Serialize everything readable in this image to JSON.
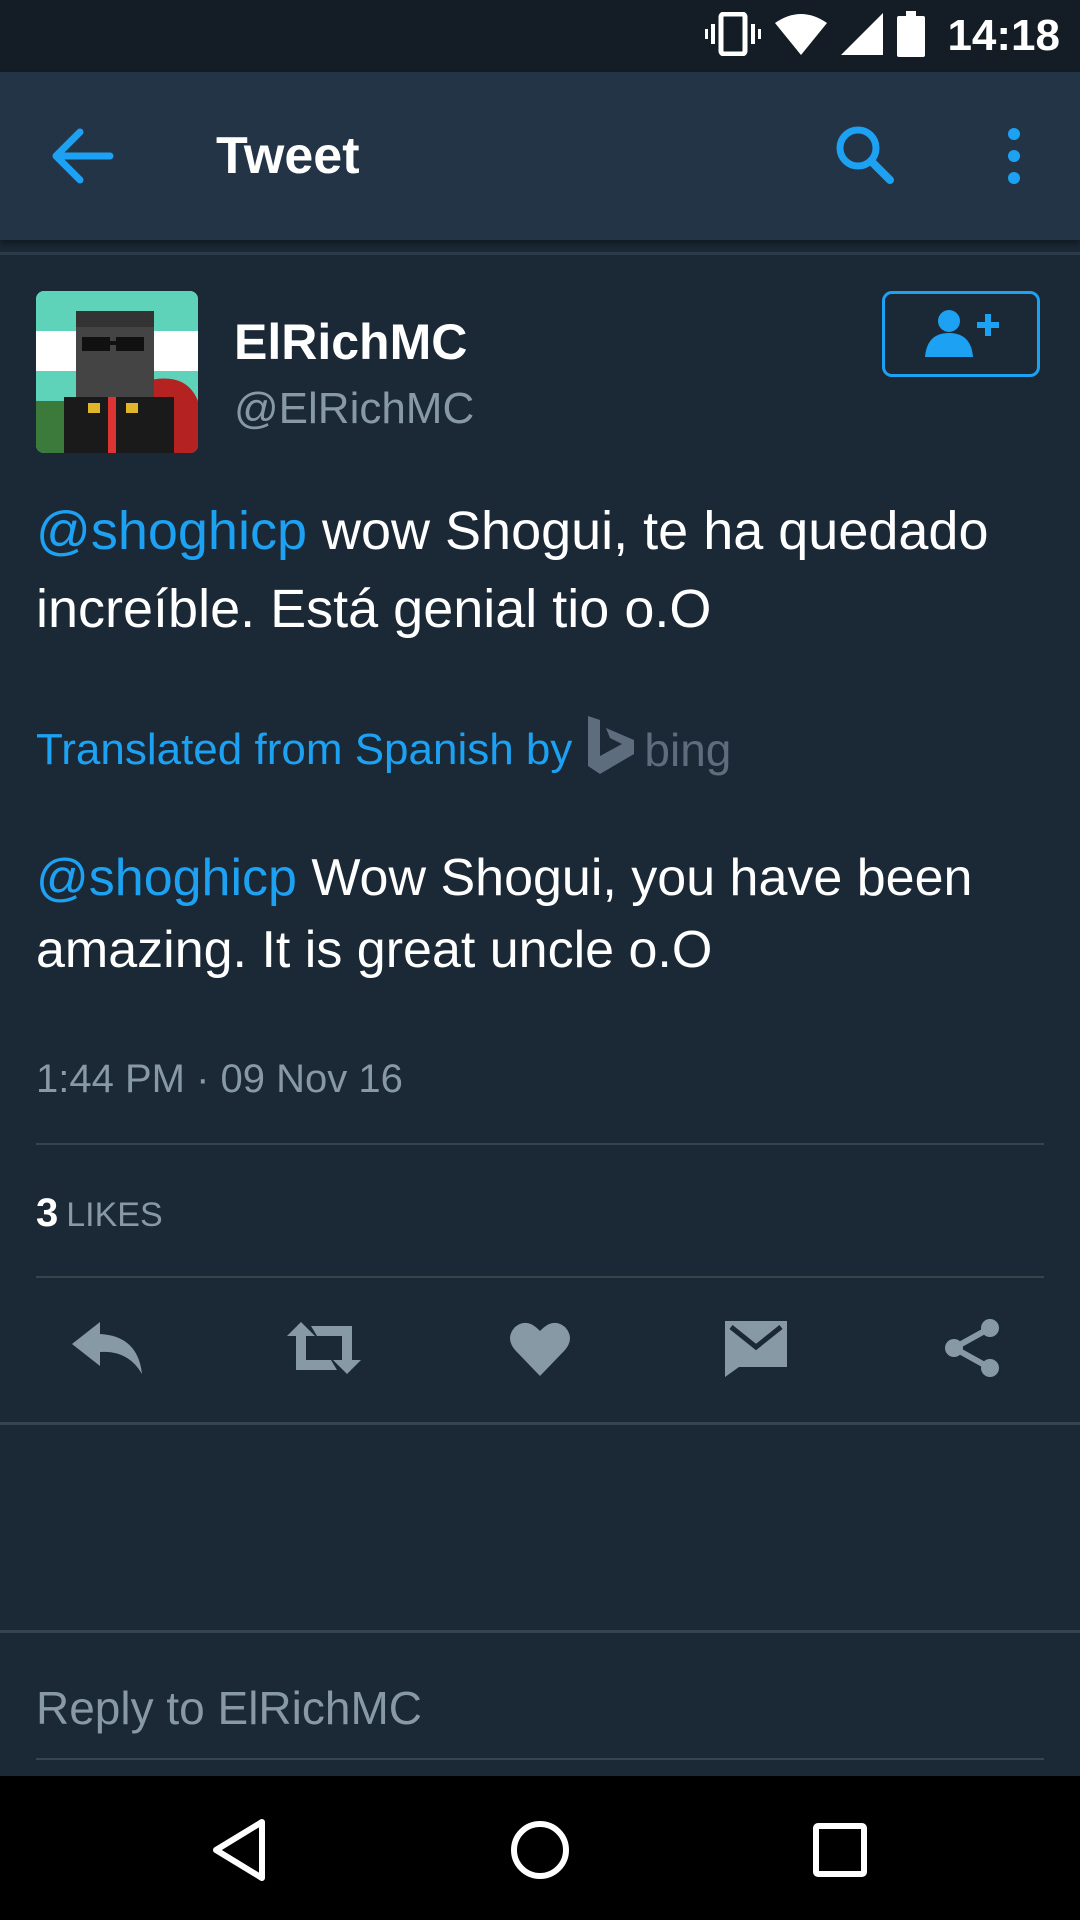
{
  "status_bar": {
    "time": "14:18",
    "icons": [
      "vibrate-icon",
      "wifi-icon",
      "signal-icon",
      "battery-icon"
    ]
  },
  "app_bar": {
    "title": "Tweet",
    "icons": [
      "back-arrow-icon",
      "search-icon",
      "more-vert-icon"
    ]
  },
  "tweet": {
    "display_name": "ElRichMC",
    "handle": "@ElRichMC",
    "mention": "@shoghicp",
    "text": " wow Shogui, te ha quedado increíble. Está genial tio o.O",
    "translated_label": "Translated from Spanish by",
    "translator": "bing",
    "translation_mention": "@shoghicp",
    "translation_text": " Wow Shogui, you have been amazing. It is great uncle o.O",
    "timestamp": "1:44 PM · 09 Nov 16",
    "likes_count": "3",
    "likes_label": "LIKES"
  },
  "actions": [
    "reply-icon",
    "retweet-icon",
    "like-icon",
    "direct-message-icon",
    "share-icon"
  ],
  "reply_placeholder": "Reply to ElRichMC",
  "colors": {
    "background": "#1b2836",
    "app_bar": "#243447",
    "status_bar": "#141d26",
    "accent": "#1da1f2",
    "secondary_text": "#8899a6",
    "action_icon": "#8899a6"
  }
}
